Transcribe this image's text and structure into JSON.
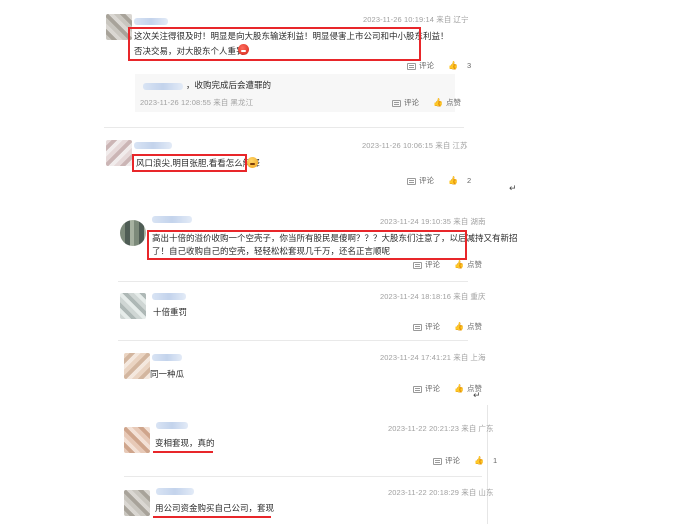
{
  "comments": [
    {
      "time": "2023-11-26 10:19:14",
      "source": "来自",
      "location": "辽宁",
      "lines": [
        "这次关注得很及时！明显是向大股东输送利益！明显侵害上市公司和中小股东利益！",
        "否决交易，对大股东个人重罚！"
      ],
      "comment_label": "评论",
      "like_count": "3"
    },
    {
      "time": "2023-11-26 10:06:15",
      "source": "来自",
      "location": "江苏",
      "lines": [
        "风口浪尖,明目张胆,看看怎么解释"
      ],
      "comment_label": "评论",
      "like_count": "2"
    },
    {
      "time": "2023-11-24 19:10:35",
      "source": "来自",
      "location": "湖南",
      "lines": [
        "高出十倍的溢价收购一个空壳子，你当所有股民是傻啊？？？大股东们注意了，以后减持又有新招",
        "了！自己收购自己的空壳，轻轻松松套现几千万，还名正言顺呢"
      ],
      "comment_label": "评论",
      "like_label": "点赞"
    },
    {
      "time": "2023-11-24 18:18:16",
      "source": "来自",
      "location": "重庆",
      "lines": [
        "十倍重罚"
      ],
      "comment_label": "评论",
      "like_label": "点赞"
    },
    {
      "time": "2023-11-24 17:41:21",
      "source": "来自",
      "location": "上海",
      "lines": [
        "同一种瓜"
      ],
      "comment_label": "评论",
      "like_label": "点赞"
    },
    {
      "time": "2023-11-22 20:21:23",
      "source": "来自",
      "location": "广东",
      "lines": [
        "变相套现，真的"
      ],
      "comment_label": "评论",
      "like_count": "1"
    },
    {
      "time": "2023-11-22 20:18:29",
      "source": "来自",
      "location": "山东",
      "lines": [
        "用公司资金购买自己公司，套现"
      ]
    }
  ],
  "reply": {
    "text": "，收购完成后会遭罪的",
    "time": "2023-11-26 12:08:55",
    "source": "来自",
    "location": "黑龙江",
    "comment_label": "评论",
    "like_label": "点赞"
  },
  "colors": {
    "highlight": "#e8262a",
    "meta": "#a0a0a0"
  },
  "icons": {
    "comment": "comment-icon",
    "like": "thumbs-up-icon",
    "paragraph": "return-mark"
  },
  "marks": {
    "return": "↵"
  }
}
